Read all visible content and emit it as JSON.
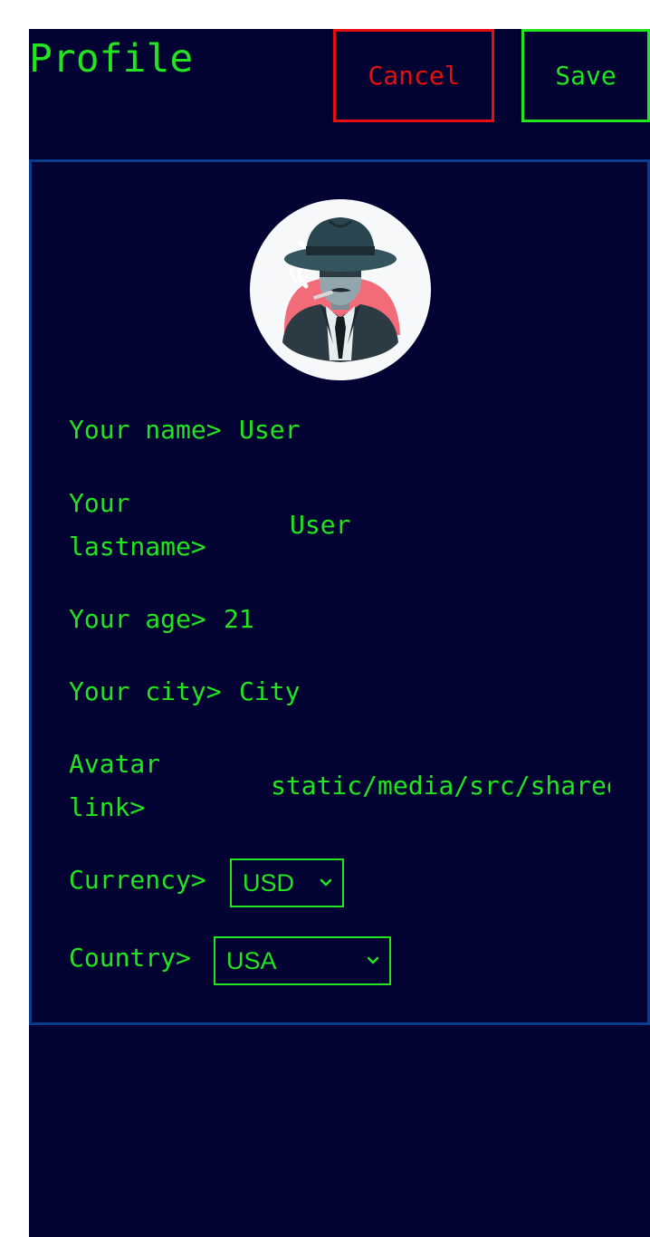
{
  "header": {
    "title": "Profile",
    "cancel_label": "Cancel",
    "save_label": "Save"
  },
  "form": {
    "name_label": "Your name>",
    "name_value": "User",
    "lastname_label_line1": "Your",
    "lastname_label_line2": "lastname>",
    "lastname_value": "User",
    "age_label": "Your age>",
    "age_value": "21",
    "city_label": "Your city>",
    "city_value": "City",
    "avatar_label_line1": "Avatar",
    "avatar_label_line2": "link>",
    "avatar_value": "static/media/src/shared/assets/avatar.png",
    "currency_label": "Currency>",
    "currency_value": "USD",
    "country_label": "Country>",
    "country_value": "USA"
  },
  "colors": {
    "background": "#020233",
    "accent": "#22e51f",
    "danger": "#e3100f",
    "card_border": "#0b3b8c"
  },
  "icons": {
    "avatar": "spy-avatar-icon",
    "select_arrow": "chevron-down-icon"
  }
}
